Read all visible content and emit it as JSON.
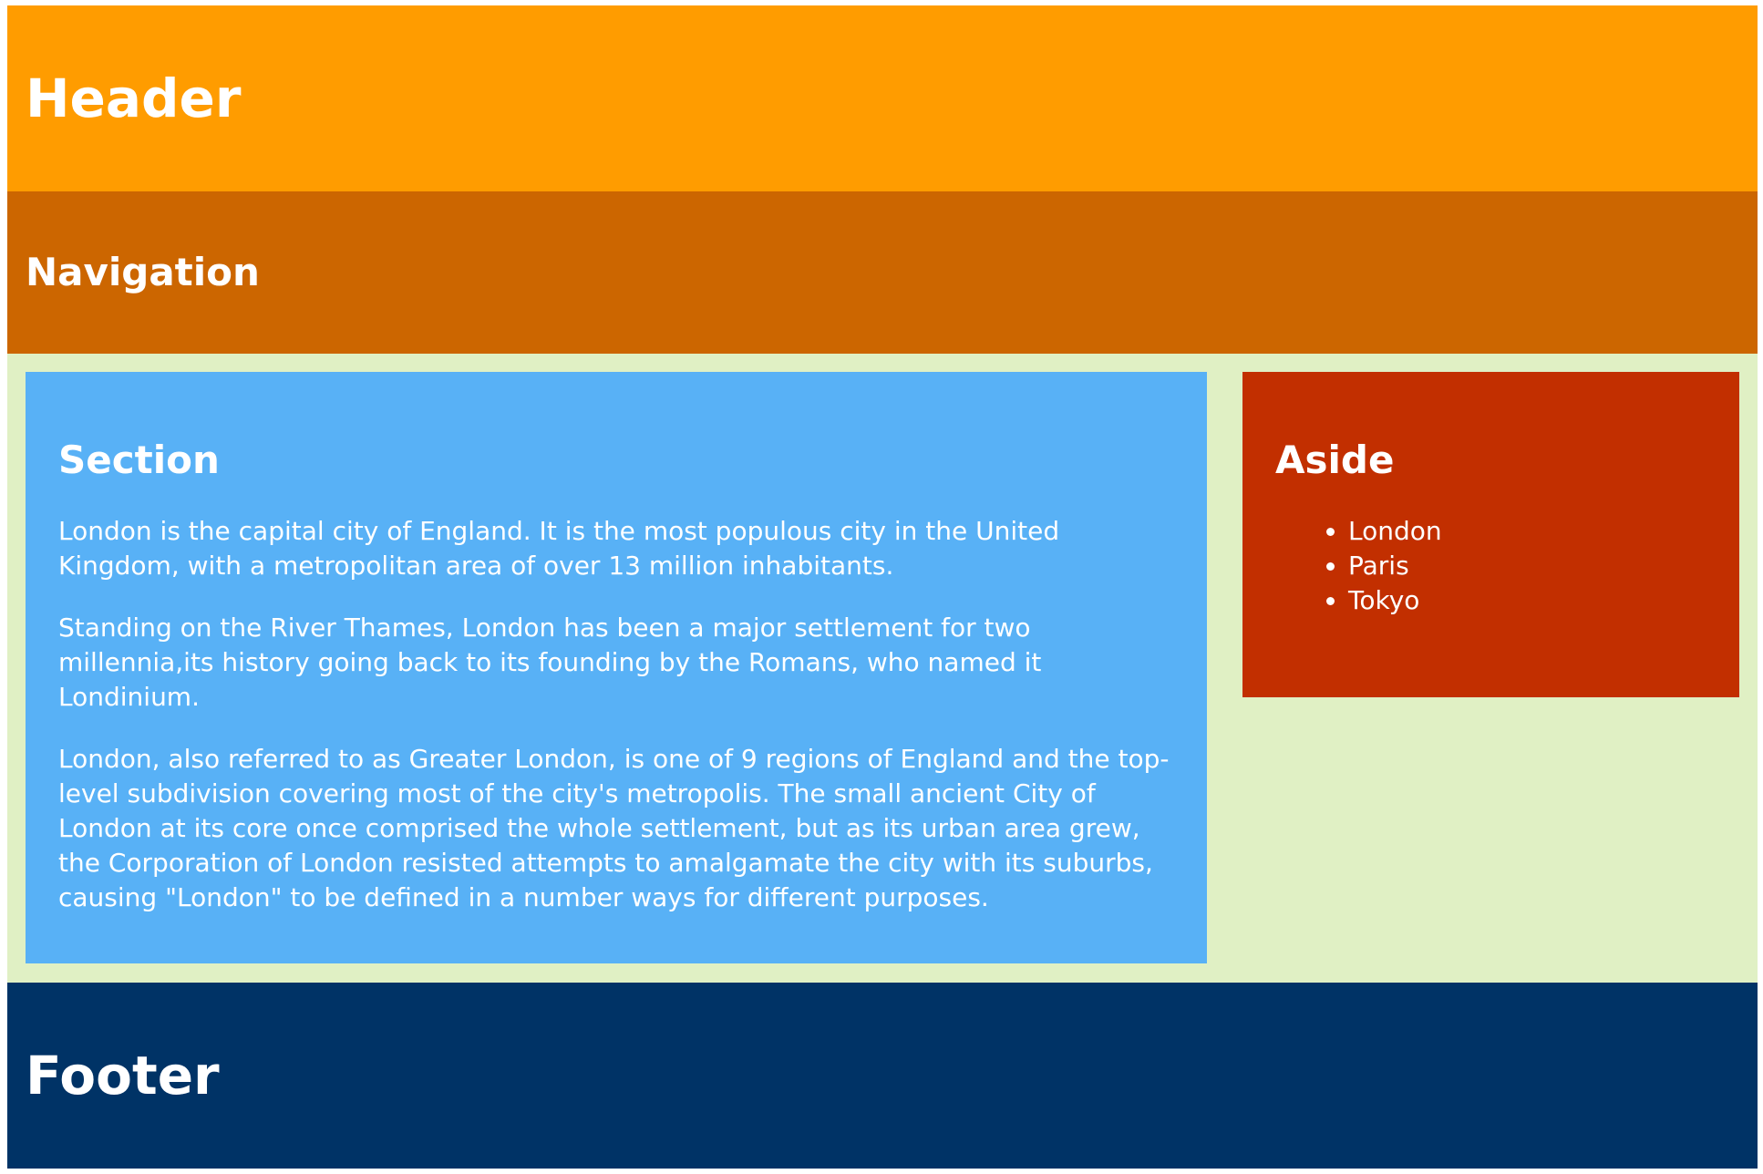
{
  "header": {
    "title": "Header"
  },
  "navigation": {
    "title": "Navigation"
  },
  "section": {
    "title": "Section",
    "paragraphs": [
      "London is the capital city of England. It is the most populous city in the United Kingdom, with a metropolitan area of over 13 million inhabitants.",
      "Standing on the River Thames, London has been a major settlement for two millennia,its history going back to its founding by the Romans, who named it Londinium.",
      "London, also referred to as Greater London, is one of 9 regions of England and the top-level subdivision covering most of the city's metropolis. The small ancient City of London at its core once comprised the whole settlement, but as its urban area grew, the Corporation of London resisted attempts to amalgamate the city with its suburbs, causing \"London\" to be defined in a number ways for different purposes."
    ]
  },
  "aside": {
    "title": "Aside",
    "items": [
      "London",
      "Paris",
      "Tokyo"
    ]
  },
  "footer": {
    "title": "Footer"
  },
  "colors": {
    "header": "#ff9c00",
    "navigation": "#cc6600",
    "main": "#e0f0c4",
    "section": "#58b1f6",
    "aside": "#c22f00",
    "footer": "#003366"
  }
}
